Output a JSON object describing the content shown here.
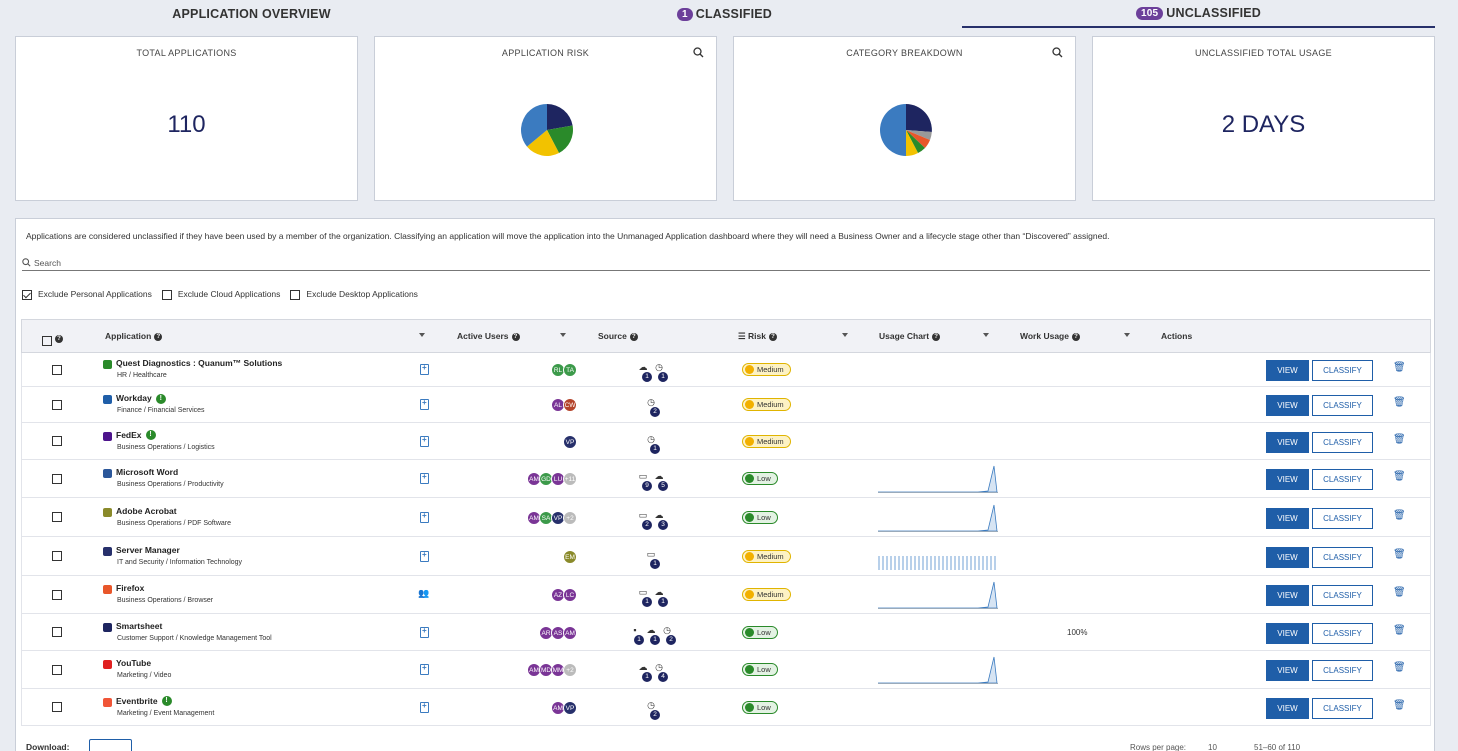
{
  "tabs": {
    "overview": "APPLICATION OVERVIEW",
    "classified": "CLASSIFIED",
    "classified_count": "1",
    "unclassified": "UNCLASSIFIED",
    "unclassified_count": "105"
  },
  "cards": {
    "total_title": "TOTAL APPLICATIONS",
    "total_value": "110",
    "risk_title": "APPLICATION RISK",
    "category_title": "CATEGORY BREAKDOWN",
    "usage_title": "UNCLASSIFIED TOTAL USAGE",
    "usage_value": "2 DAYS"
  },
  "panel": {
    "note": "Applications are considered unclassified if they have been used by a member of the organization. Classifying an application will move the application into the Unmanaged Application dashboard where they will need a Business Owner and a lifecycle stage other than “Discovered” assigned.",
    "search_placeholder": "Search",
    "filters": [
      "Exclude Personal Applications",
      "Exclude Cloud Applications",
      "Exclude Desktop Applications"
    ]
  },
  "table": {
    "headers": {
      "application": "Application",
      "active_users": "Active Users",
      "source": "Source",
      "risk": "Risk",
      "usage_chart": "Usage Chart",
      "work_usage": "Work Usage",
      "actions": "Actions"
    },
    "view_label": "VIEW",
    "classify_label": "CLASSIFY",
    "rows": [
      {
        "name": "Quest Diagnostics : Quanum™ Solutions",
        "cat": "HR / Healthcare",
        "icon_color": "#2a8a2a",
        "excl": false,
        "users": [
          {
            "i": "RL",
            "c": "#3c9a4a"
          },
          {
            "i": "TA",
            "c": "#3c9a4a"
          }
        ],
        "sources": [
          {
            "g": "☁",
            "n": "1"
          },
          {
            "g": "◷",
            "n": "1"
          }
        ],
        "risk": "Medium",
        "work": "",
        "chart": "none"
      },
      {
        "name": "Workday",
        "cat": "Finance / Financial Services",
        "icon_color": "#1f5ea8",
        "excl": true,
        "users": [
          {
            "i": "AL",
            "c": "#7a3596"
          },
          {
            "i": "CW",
            "c": "#b4432a"
          }
        ],
        "sources": [
          {
            "g": "◷",
            "n": "2"
          }
        ],
        "risk": "Medium",
        "work": "",
        "chart": "none"
      },
      {
        "name": "FedEx",
        "cat": "Business Operations / Logistics",
        "icon_color": "#4d148c",
        "excl": true,
        "users": [
          {
            "i": "VP",
            "c": "#27306b"
          }
        ],
        "sources": [
          {
            "g": "◷",
            "n": "1"
          }
        ],
        "risk": "Medium",
        "work": "",
        "chart": "none"
      },
      {
        "name": "Microsoft Word",
        "cat": "Business Operations / Productivity",
        "icon_color": "#2b579a",
        "excl": false,
        "users": [
          {
            "i": "AM",
            "c": "#7a3596"
          },
          {
            "i": "GD",
            "c": "#3c9a4a"
          },
          {
            "i": "LU",
            "c": "#7a3596"
          },
          {
            "i": "+11",
            "c": "#bbbbbb"
          }
        ],
        "sources": [
          {
            "g": "▭",
            "n": "9"
          },
          {
            "g": "☁",
            "n": "5"
          }
        ],
        "risk": "Low",
        "work": "",
        "chart": "spike"
      },
      {
        "name": "Adobe Acrobat",
        "cat": "Business Operations / PDF Software",
        "icon_color": "#8a8a2a",
        "excl": false,
        "users": [
          {
            "i": "AM",
            "c": "#7a3596"
          },
          {
            "i": "SA",
            "c": "#3c9a4a"
          },
          {
            "i": "VP",
            "c": "#27306b"
          },
          {
            "i": "+2",
            "c": "#bbbbbb"
          }
        ],
        "sources": [
          {
            "g": "▭",
            "n": "2"
          },
          {
            "g": "☁",
            "n": "3"
          }
        ],
        "risk": "Low",
        "work": "",
        "chart": "spike"
      },
      {
        "name": "Server Manager",
        "cat": "IT and Security / Information Technology",
        "icon_color": "#27306b",
        "excl": false,
        "users": [
          {
            "i": "EM",
            "c": "#8a8a2a"
          }
        ],
        "sources": [
          {
            "g": "▭",
            "n": "1"
          }
        ],
        "risk": "Medium",
        "work": "",
        "chart": "flat"
      },
      {
        "name": "Firefox",
        "cat": "Business Operations / Browser",
        "icon_color": "#e8562a",
        "excl": false,
        "users": [
          {
            "i": "AZ",
            "c": "#7a3596"
          },
          {
            "i": "LC",
            "c": "#7a3596"
          }
        ],
        "sources": [
          {
            "g": "▭",
            "n": "1"
          },
          {
            "g": "☁",
            "n": "1"
          }
        ],
        "risk": "Medium",
        "work": "",
        "chart": "spike",
        "group": "2"
      },
      {
        "name": "Smartsheet",
        "cat": "Customer Support / Knowledge Management Tool",
        "icon_color": "#1e2560",
        "excl": false,
        "users": [
          {
            "i": "AR",
            "c": "#7a3596"
          },
          {
            "i": "AS",
            "c": "#7a3596"
          },
          {
            "i": "AM",
            "c": "#7a3596"
          }
        ],
        "sources": [
          {
            "g": "▪",
            "n": "1"
          },
          {
            "g": "☁",
            "n": "1"
          },
          {
            "g": "◷",
            "n": "2"
          }
        ],
        "risk": "Low",
        "work": "100%",
        "chart": "none"
      },
      {
        "name": "YouTube",
        "cat": "Marketing / Video",
        "icon_color": "#e02020",
        "excl": false,
        "users": [
          {
            "i": "AM",
            "c": "#7a3596"
          },
          {
            "i": "MD",
            "c": "#7a3596"
          },
          {
            "i": "MM",
            "c": "#7a3596"
          },
          {
            "i": "+2",
            "c": "#bbbbbb"
          }
        ],
        "sources": [
          {
            "g": "☁",
            "n": "1"
          },
          {
            "g": "◷",
            "n": "4"
          }
        ],
        "risk": "Low",
        "work": "",
        "chart": "spike"
      },
      {
        "name": "Eventbrite",
        "cat": "Marketing / Event Management",
        "icon_color": "#f05537",
        "excl": true,
        "users": [
          {
            "i": "AM",
            "c": "#7a3596"
          },
          {
            "i": "VP",
            "c": "#27306b"
          }
        ],
        "sources": [
          {
            "g": "◷",
            "n": "2"
          }
        ],
        "risk": "Low",
        "work": "",
        "chart": "none"
      }
    ]
  },
  "footer": {
    "download": "Download:",
    "rows_per_page": "Rows per page:",
    "rows_value": "10",
    "range": "51–60 of 110"
  },
  "colors": {
    "accent": "#1f5ea8",
    "navy": "#1e2560",
    "badge": "#6c3f9a"
  }
}
